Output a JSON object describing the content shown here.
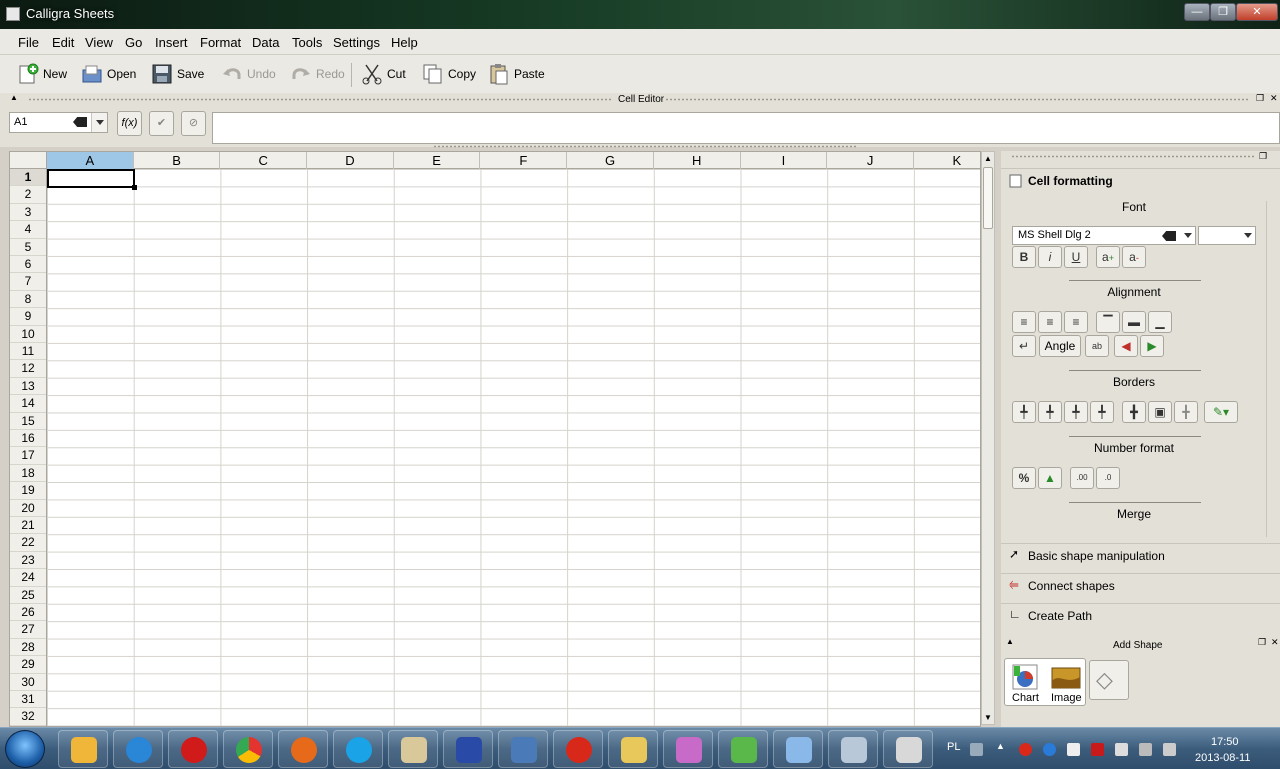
{
  "window": {
    "title": "Calligra Sheets"
  },
  "menu": [
    "File",
    "Edit",
    "View",
    "Go",
    "Insert",
    "Format",
    "Data",
    "Tools",
    "Settings",
    "Help"
  ],
  "toolbar": {
    "new": "New",
    "open": "Open",
    "save": "Save",
    "undo": "Undo",
    "redo": "Redo",
    "cut": "Cut",
    "copy": "Copy",
    "paste": "Paste"
  },
  "cell_editor": {
    "title": "Cell Editor",
    "cell_ref": "A1",
    "fx_label": "f(x)",
    "formula_value": ""
  },
  "sheet": {
    "columns": [
      "A",
      "B",
      "C",
      "D",
      "E",
      "F",
      "G",
      "H",
      "I",
      "J",
      "K"
    ],
    "rows": [
      "1",
      "2",
      "3",
      "4",
      "5",
      "6",
      "7",
      "8",
      "9",
      "10",
      "11",
      "12",
      "13",
      "14",
      "15",
      "16",
      "17",
      "18",
      "19",
      "20",
      "21",
      "22",
      "23",
      "24",
      "25",
      "26",
      "27",
      "28",
      "29",
      "30",
      "31",
      "32"
    ],
    "selected_cell": "A1"
  },
  "docker": {
    "cell_formatting": "Cell formatting",
    "font_section": "Font",
    "font_name": "MS Shell Dlg 2",
    "font_size": "",
    "alignment_section": "Alignment",
    "angle_label": "Angle",
    "borders_section": "Borders",
    "number_format_section": "Number format",
    "percent_label": "%",
    "merge_section": "Merge",
    "tools": [
      "Basic shape manipulation",
      "Connect shapes",
      "Create Path"
    ],
    "add_shape_title": "Add Shape",
    "shapes": [
      "Chart",
      "Image"
    ]
  },
  "taskbar": {
    "lang": "PL",
    "time": "17:50",
    "date": "2013-08-11"
  }
}
